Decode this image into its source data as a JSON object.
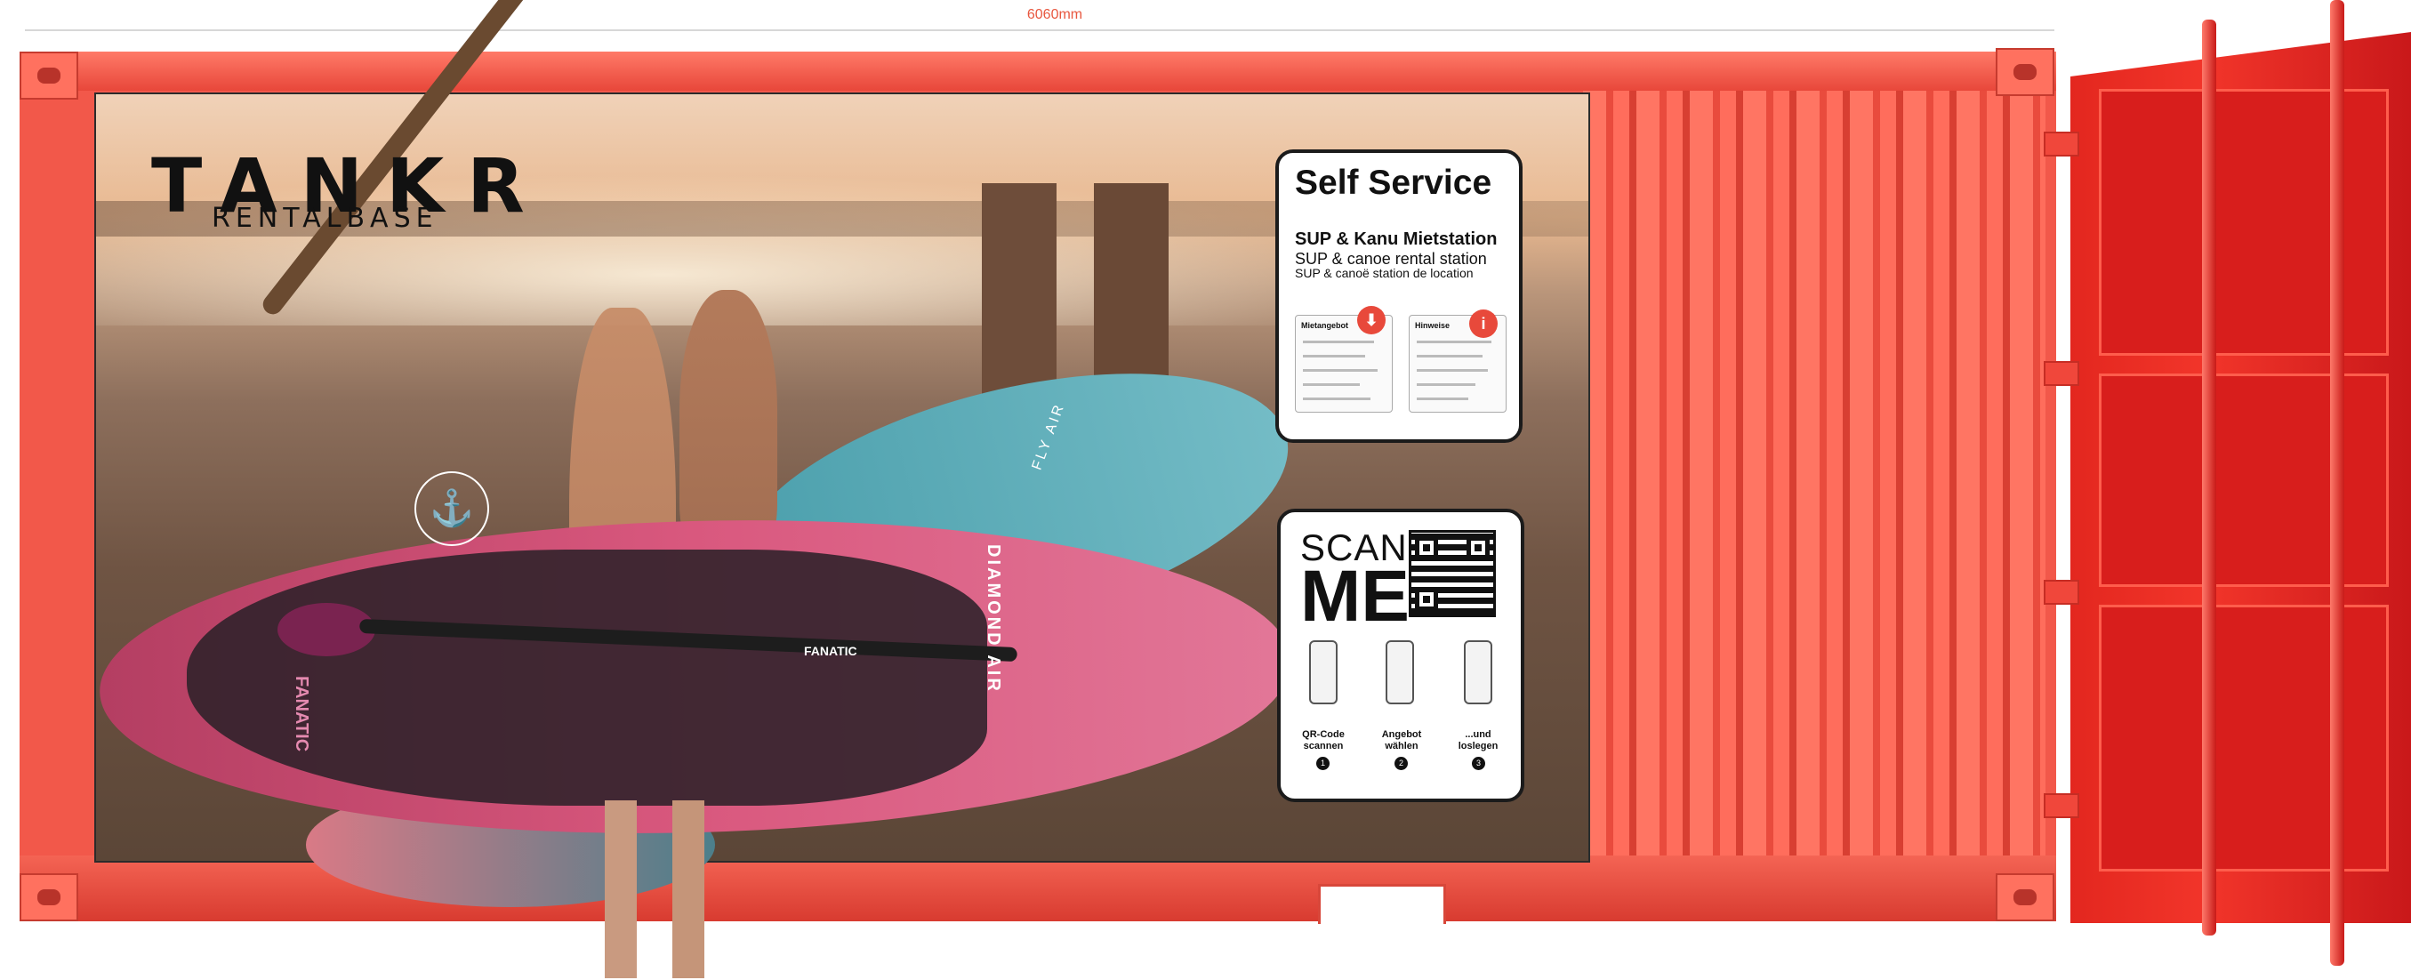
{
  "dimension": {
    "label": "6060mm"
  },
  "brand": {
    "name": "TANKR",
    "subtitle": "RENTALBASE"
  },
  "self_service": {
    "title": "Self Service",
    "heading": "SUP & Kanu Mietstation",
    "line_en": "SUP & canoe rental station",
    "line_fr": "SUP & canoë station de location",
    "doc1_title": "Mietangebot",
    "doc2_title": "Hinweise",
    "pin1_icon": "download-pin-icon",
    "pin2_icon": "info-pin-icon",
    "pin2_glyph": "i"
  },
  "scan": {
    "line1": "SCAN",
    "line2": "ME",
    "steps": [
      {
        "label_1": "QR-Code",
        "label_2": "scannen",
        "num": "1"
      },
      {
        "label_1": "Angebot",
        "label_2": "wählen",
        "num": "2"
      },
      {
        "label_1": "...und",
        "label_2": "loslegen",
        "num": "3"
      }
    ]
  },
  "boards": {
    "pink_name": "DIAMOND AIR",
    "brand": "FANATIC",
    "blue_name": "FLY AIR",
    "side_text": "FANATIC"
  },
  "colors": {
    "container": "#f2584a",
    "door": "#e3271f",
    "dimension": "#e8573f"
  }
}
